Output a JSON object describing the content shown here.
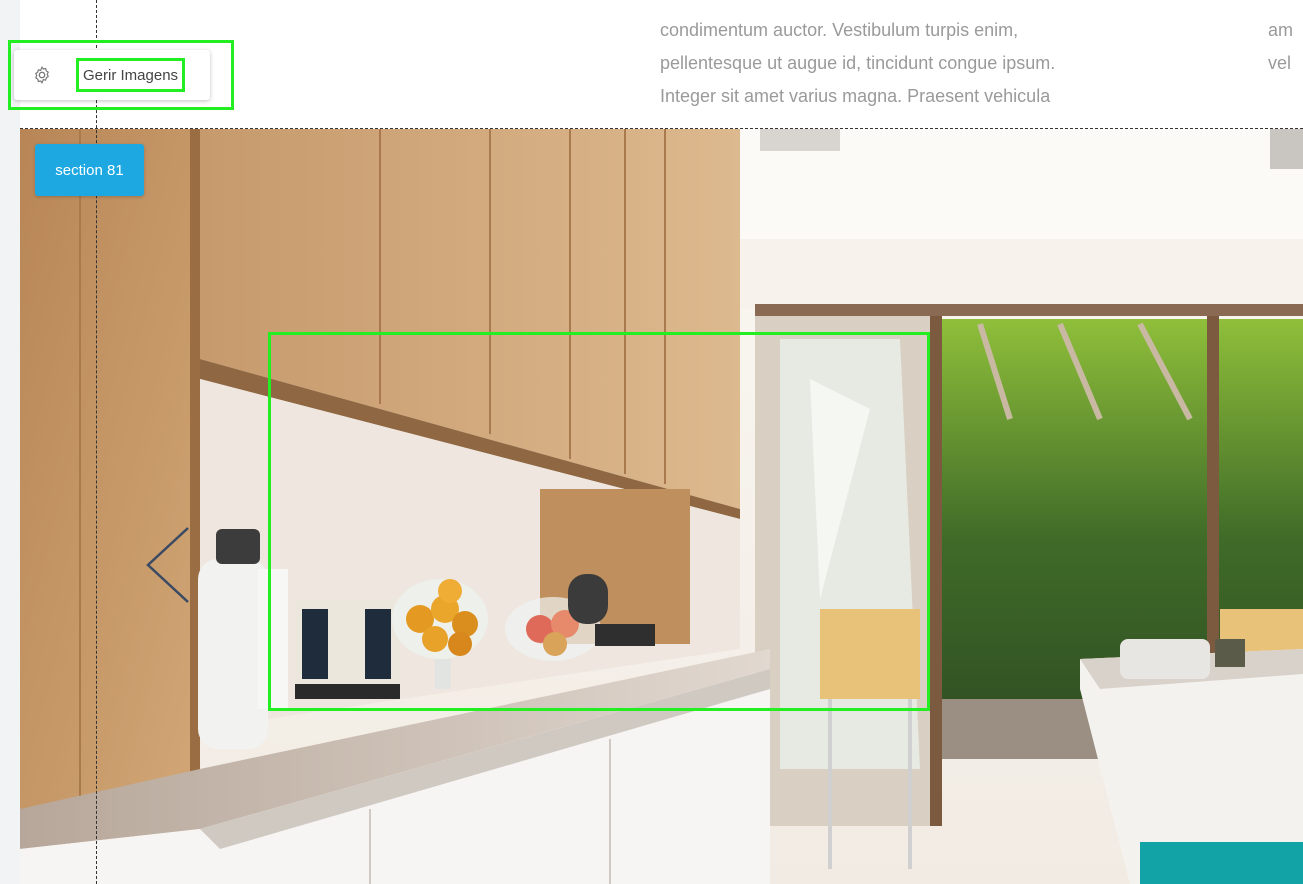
{
  "toolbar": {
    "gear_icon": "gear-icon",
    "manage_images_label": "Gerir Imagens"
  },
  "text_block": {
    "main_lines": [
      "condimentum auctor. Vestibulum turpis enim,",
      "pellentesque ut augue id, tincidunt congue ipsum.",
      "Integer sit amet varius magna. Praesent vehicula"
    ],
    "side_lines": [
      "am",
      "vel"
    ]
  },
  "section": {
    "badge_label": "section 81",
    "image": "kitchen-photo",
    "prev_icon": "chevron-left-icon"
  },
  "colors": {
    "badge": "#1da8e2",
    "selection_outline": "#22ee22",
    "teal_block": "#11a3a6",
    "text": "#9a9a9a"
  }
}
